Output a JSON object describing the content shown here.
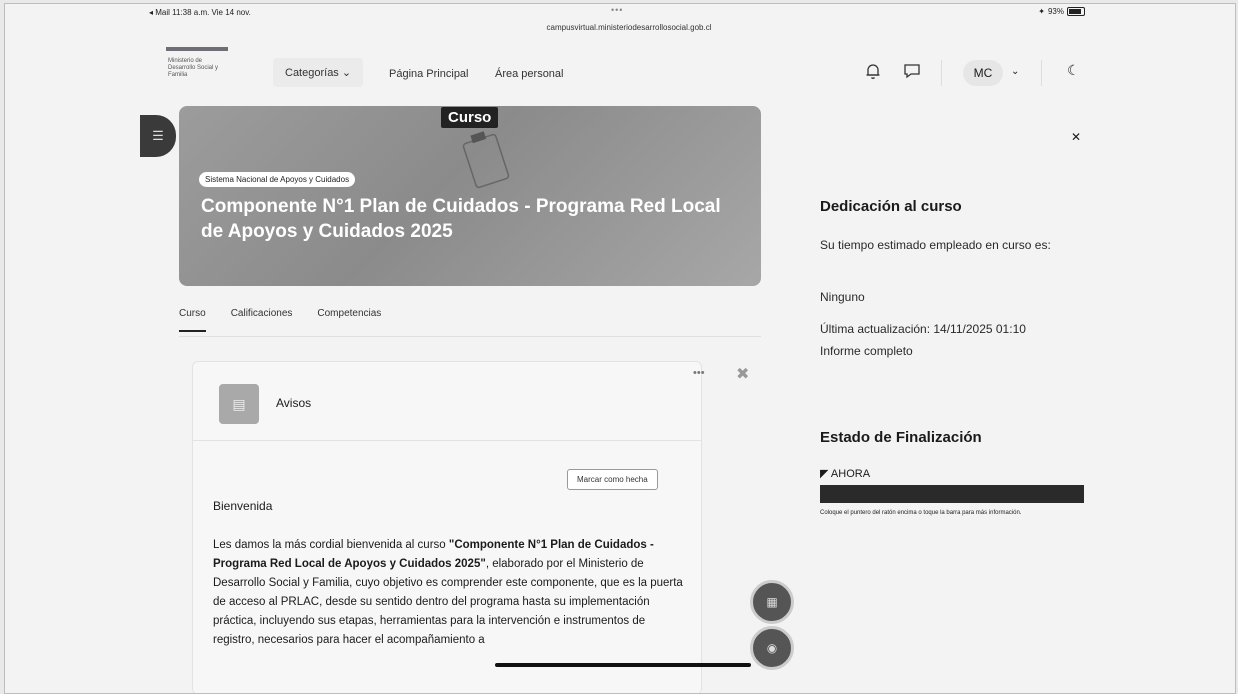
{
  "status_bar": {
    "left": "◂ Mail  11:38 a.m.  Vie 14 nov.",
    "url": "campusvirtual.ministeriodesarrollosocial.gob.cl",
    "battery": "93%"
  },
  "nav": {
    "logo_text": "Ministerio de Desarrollo Social y Familia",
    "categories": "Categorías",
    "home": "Página Principal",
    "personal": "Área personal",
    "avatar": "MC"
  },
  "course": {
    "tag": "Curso",
    "category": "Sistema Nacional de Apoyos y Cuidados",
    "title": "Componente N°1 Plan de Cuidados - Programa Red Local de Apoyos y Cuidados 2025"
  },
  "tabs": [
    "Curso",
    "Calificaciones",
    "Competencias"
  ],
  "card": {
    "title": "Avisos",
    "mark_done": "Marcar como hecha",
    "welcome": "Bienvenida",
    "body_pre": "Les damos la más cordial bienvenida al curso ",
    "body_bold": "\"Componente N°1 Plan de Cuidados - Programa Red Local de Apoyos y Cuidados 2025\"",
    "body_post": ", elaborado por el Ministerio de Desarrollo Social y Familia, cuyo objetivo es comprender este componente, que es la puerta de acceso al PRLAC, desde su sentido dentro del programa hasta su implementación práctica, incluyendo sus etapas, herramientas para la intervención e instrumentos de registro, necesarios para hacer el acompañamiento a"
  },
  "right": {
    "dedication_title": "Dedicación al curso",
    "estimate_text": "Su tiempo estimado empleado en curso es:",
    "estimate_value": "Ninguno",
    "last_update": "Última actualización: 14/11/2025 01:10",
    "report": "Informe completo",
    "completion_title": "Estado de Finalización",
    "progress_label": "AHORA",
    "progress_hint": "Coloque el puntero del ratón encima o toque la barra para más información."
  }
}
